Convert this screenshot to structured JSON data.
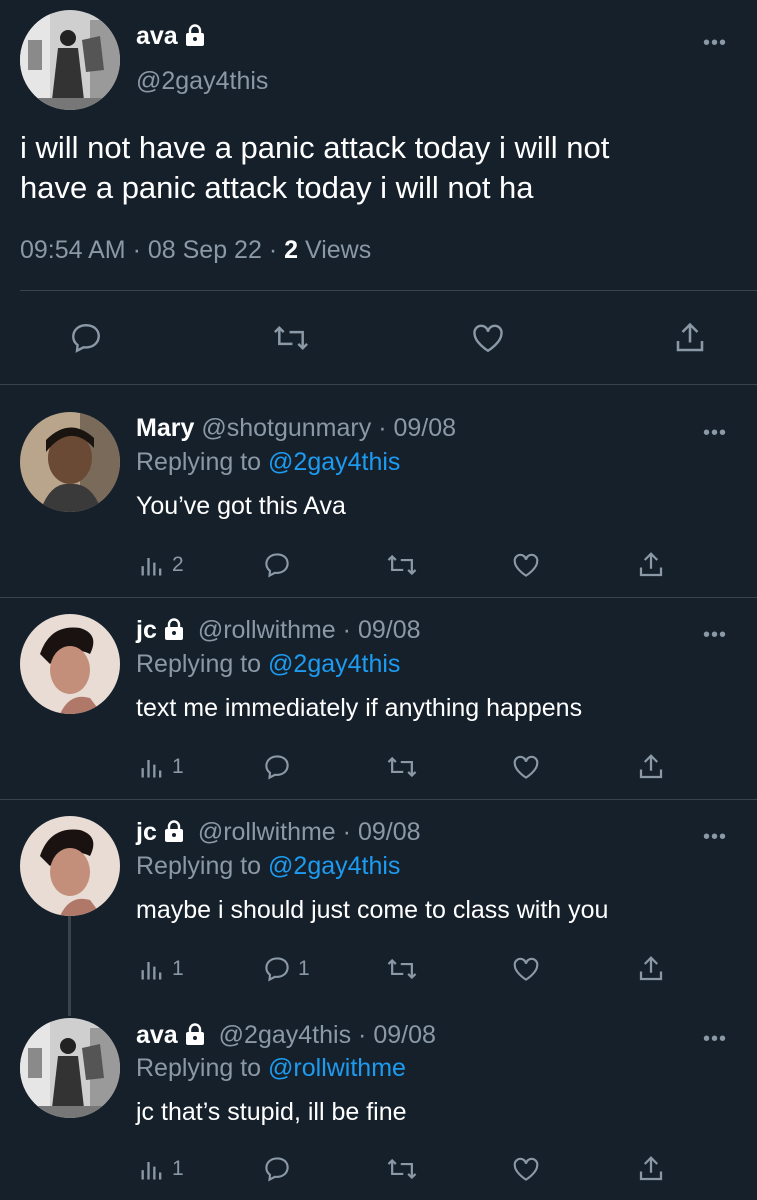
{
  "main_tweet": {
    "author_name": "ava",
    "author_handle": "@2gay4this",
    "text_line1": "i will not have a panic attack today i will not",
    "text_line2": "have a panic attack today i will not ha",
    "time": "09:54 AM",
    "date": "08 Sep 22",
    "views_count": "2",
    "views_label": "Views",
    "more_label": "•••"
  },
  "replies": [
    {
      "author_name": "Mary",
      "author_handle": "@shotgunmary",
      "date": "09/08",
      "replying_to_label": "Replying to",
      "replying_to": "@2gay4this",
      "text": "You’ve got this Ava",
      "views": "2",
      "reply_count": "",
      "locked": false
    },
    {
      "author_name": "jc",
      "author_handle": "@rollwithme",
      "date": "09/08",
      "replying_to_label": "Replying to",
      "replying_to": "@2gay4this",
      "text": "text me immediately if anything happens",
      "views": "1",
      "reply_count": "",
      "locked": true
    },
    {
      "author_name": "jc",
      "author_handle": "@rollwithme",
      "date": "09/08",
      "replying_to_label": "Replying to",
      "replying_to": "@2gay4this",
      "text": "maybe i should just come to class with you",
      "views": "1",
      "reply_count": "1",
      "locked": true
    },
    {
      "author_name": "ava",
      "author_handle": "@2gay4this",
      "date": "09/08",
      "replying_to_label": "Replying to",
      "replying_to": "@rollwithme",
      "text": "jc that’s stupid, ill be fine",
      "views": "1",
      "reply_count": "",
      "locked": true
    }
  ],
  "separator": "·",
  "colors": {
    "background": "#15202b",
    "muted": "#8b98a5",
    "link": "#1d9bf0",
    "divider": "#38444d"
  },
  "icons": [
    "lock-icon",
    "more-icon",
    "reply-icon",
    "retweet-icon",
    "like-icon",
    "share-icon",
    "views-icon"
  ]
}
